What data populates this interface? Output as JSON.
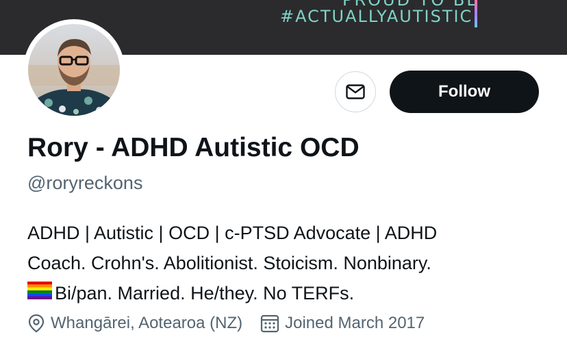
{
  "banner": {
    "line1": "PROUD TO BE",
    "line2": "#ACTUALLYAUTISTIC"
  },
  "profile": {
    "display_name": "Rory - ADHD Autistic OCD",
    "handle": "@roryreckons",
    "bio_lines": [
      "ADHD | Autistic | OCD | c-PTSD Advocate | ADHD",
      "Coach. Crohn's. Abolitionist. Stoicism. Nonbinary.",
      "Bi/pan. Married. He/they. No TERFs."
    ],
    "location": "Whangārei, Aotearoa (NZ)",
    "joined": "Joined March 2017"
  },
  "actions": {
    "follow_label": "Follow",
    "message_icon": "mail-icon"
  },
  "colors": {
    "banner_bg": "#2b2b2d",
    "banner_text": "#7fd3c9",
    "follow_bg": "#0f1419",
    "secondary_text": "#536471"
  }
}
